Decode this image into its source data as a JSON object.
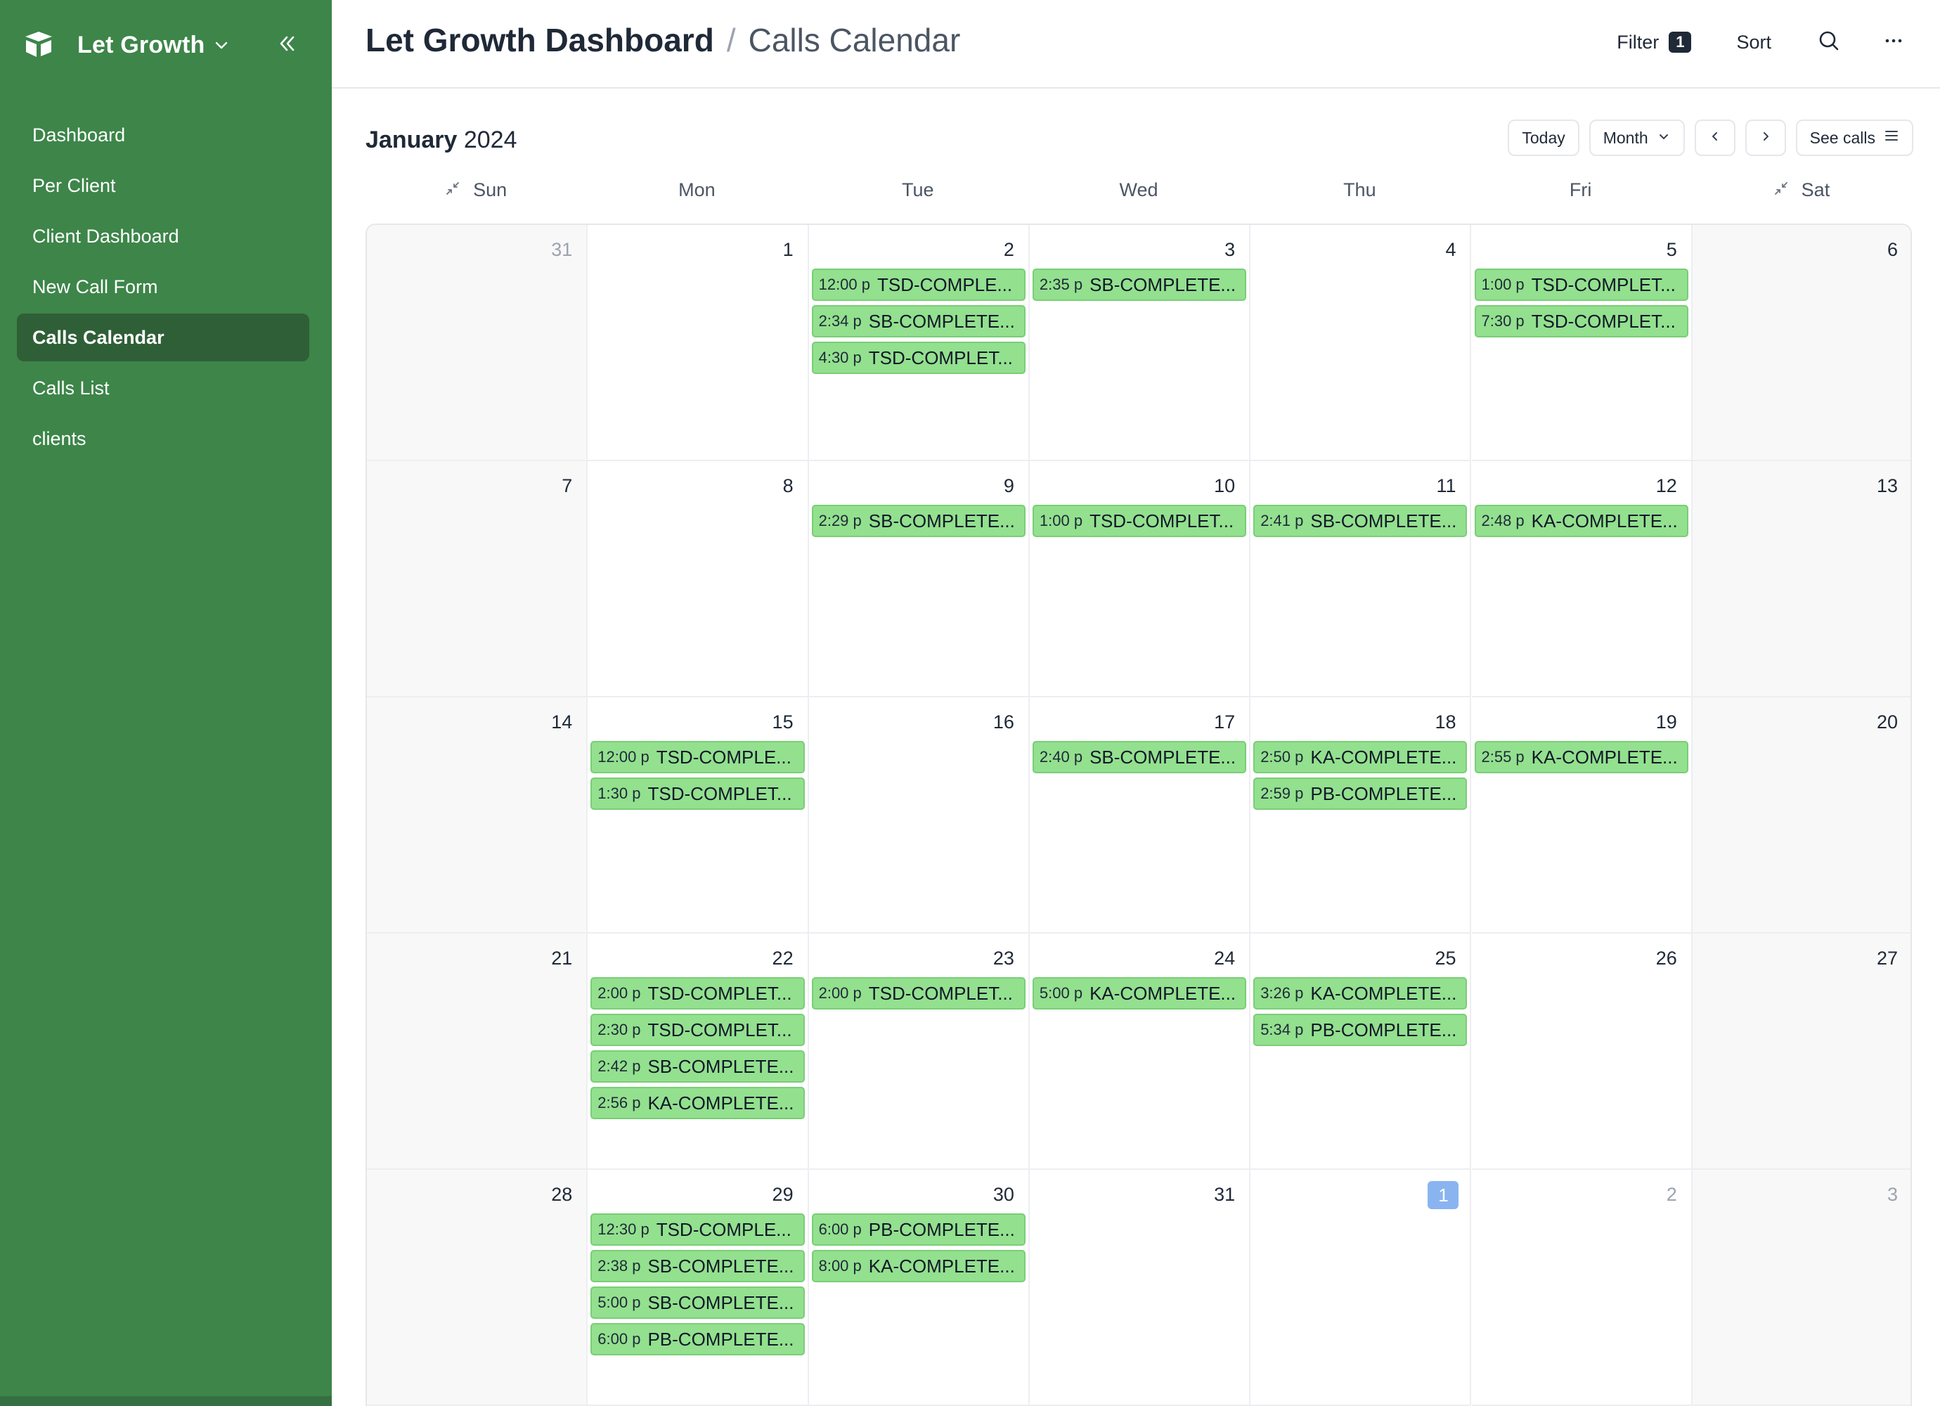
{
  "sidebar": {
    "workspace_name": "Let Growth",
    "nav": [
      {
        "label": "Dashboard",
        "active": false
      },
      {
        "label": "Per Client",
        "active": false
      },
      {
        "label": "Client Dashboard",
        "active": false
      },
      {
        "label": "New Call Form",
        "active": false
      },
      {
        "label": "Calls Calendar",
        "active": true
      },
      {
        "label": "Calls List",
        "active": false
      },
      {
        "label": "clients",
        "active": false
      }
    ]
  },
  "header": {
    "title": "Let Growth Dashboard",
    "separator": "/",
    "subtitle": "Calls Calendar",
    "filter_label": "Filter",
    "filter_count": "1",
    "sort_label": "Sort"
  },
  "toolbar": {
    "month": "January",
    "year": "2024",
    "today_label": "Today",
    "view_label": "Month",
    "see_calls_label": "See calls"
  },
  "weekdays": [
    "Sun",
    "Mon",
    "Tue",
    "Wed",
    "Thu",
    "Fri",
    "Sat"
  ],
  "colors": {
    "sidebar": "#3d8549",
    "sidebar_active": "#2f5f37",
    "event_bg": "#93e08f",
    "today_badge": "#8ab4f0"
  },
  "weeks": [
    [
      {
        "day": "31",
        "muted": true,
        "events": []
      },
      {
        "day": "1",
        "events": []
      },
      {
        "day": "2",
        "events": [
          {
            "time": "12:00 p",
            "title": "TSD-COMPLE..."
          },
          {
            "time": "2:34 p",
            "title": "SB-COMPLETE..."
          },
          {
            "time": "4:30 p",
            "title": "TSD-COMPLET..."
          }
        ]
      },
      {
        "day": "3",
        "events": [
          {
            "time": "2:35 p",
            "title": "SB-COMPLETE..."
          }
        ]
      },
      {
        "day": "4",
        "events": []
      },
      {
        "day": "5",
        "events": [
          {
            "time": "1:00 p",
            "title": "TSD-COMPLET..."
          },
          {
            "time": "7:30 p",
            "title": "TSD-COMPLET..."
          }
        ]
      },
      {
        "day": "6",
        "events": []
      }
    ],
    [
      {
        "day": "7",
        "events": []
      },
      {
        "day": "8",
        "events": []
      },
      {
        "day": "9",
        "events": [
          {
            "time": "2:29 p",
            "title": "SB-COMPLETE..."
          }
        ]
      },
      {
        "day": "10",
        "events": [
          {
            "time": "1:00 p",
            "title": "TSD-COMPLET..."
          }
        ]
      },
      {
        "day": "11",
        "events": [
          {
            "time": "2:41 p",
            "title": "SB-COMPLETE..."
          }
        ]
      },
      {
        "day": "12",
        "events": [
          {
            "time": "2:48 p",
            "title": "KA-COMPLETE..."
          }
        ]
      },
      {
        "day": "13",
        "events": []
      }
    ],
    [
      {
        "day": "14",
        "events": []
      },
      {
        "day": "15",
        "events": [
          {
            "time": "12:00 p",
            "title": "TSD-COMPLE..."
          },
          {
            "time": "1:30 p",
            "title": "TSD-COMPLET..."
          }
        ]
      },
      {
        "day": "16",
        "events": []
      },
      {
        "day": "17",
        "events": [
          {
            "time": "2:40 p",
            "title": "SB-COMPLETE..."
          }
        ]
      },
      {
        "day": "18",
        "events": [
          {
            "time": "2:50 p",
            "title": "KA-COMPLETE..."
          },
          {
            "time": "2:59 p",
            "title": "PB-COMPLETE..."
          }
        ]
      },
      {
        "day": "19",
        "events": [
          {
            "time": "2:55 p",
            "title": "KA-COMPLETE..."
          }
        ]
      },
      {
        "day": "20",
        "events": []
      }
    ],
    [
      {
        "day": "21",
        "events": []
      },
      {
        "day": "22",
        "events": [
          {
            "time": "2:00 p",
            "title": "TSD-COMPLET..."
          },
          {
            "time": "2:30 p",
            "title": "TSD-COMPLET..."
          },
          {
            "time": "2:42 p",
            "title": "SB-COMPLETE..."
          },
          {
            "time": "2:56 p",
            "title": "KA-COMPLETE..."
          }
        ]
      },
      {
        "day": "23",
        "events": [
          {
            "time": "2:00 p",
            "title": "TSD-COMPLET..."
          }
        ]
      },
      {
        "day": "24",
        "events": [
          {
            "time": "5:00 p",
            "title": "KA-COMPLETE..."
          }
        ]
      },
      {
        "day": "25",
        "events": [
          {
            "time": "3:26 p",
            "title": "KA-COMPLETE..."
          },
          {
            "time": "5:34 p",
            "title": "PB-COMPLETE..."
          }
        ]
      },
      {
        "day": "26",
        "events": []
      },
      {
        "day": "27",
        "events": []
      }
    ],
    [
      {
        "day": "28",
        "events": []
      },
      {
        "day": "29",
        "events": [
          {
            "time": "12:30 p",
            "title": "TSD-COMPLE..."
          },
          {
            "time": "2:38 p",
            "title": "SB-COMPLETE..."
          },
          {
            "time": "5:00 p",
            "title": "SB-COMPLETE..."
          },
          {
            "time": "6:00 p",
            "title": "PB-COMPLETE..."
          }
        ]
      },
      {
        "day": "30",
        "events": [
          {
            "time": "6:00 p",
            "title": "PB-COMPLETE..."
          },
          {
            "time": "8:00 p",
            "title": "KA-COMPLETE..."
          }
        ]
      },
      {
        "day": "31",
        "events": []
      },
      {
        "day": "1",
        "today": true,
        "events": []
      },
      {
        "day": "2",
        "muted": true,
        "events": []
      },
      {
        "day": "3",
        "muted": true,
        "events": []
      }
    ]
  ]
}
